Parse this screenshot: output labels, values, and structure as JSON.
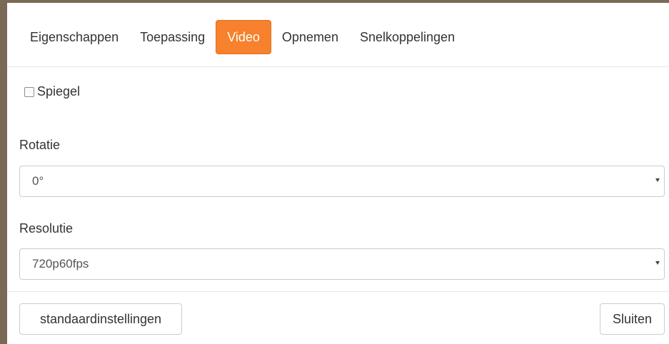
{
  "tabs": [
    {
      "label": "Eigenschappen",
      "active": false
    },
    {
      "label": "Toepassing",
      "active": false
    },
    {
      "label": "Video",
      "active": true
    },
    {
      "label": "Opnemen",
      "active": false
    },
    {
      "label": "Snelkoppelingen",
      "active": false
    }
  ],
  "mirror": {
    "label": "Spiegel",
    "checked": false
  },
  "rotation": {
    "label": "Rotatie",
    "value": "0°"
  },
  "resolution": {
    "label": "Resolutie",
    "value": "720p60fps"
  },
  "footer": {
    "defaults_label": "standaardinstellingen",
    "close_label": "Sluiten"
  },
  "colors": {
    "accent": "#f7812c",
    "window_border": "#7a6a55"
  },
  "icons": {
    "dropdown": "caret-down-icon",
    "checkbox": "checkbox-unchecked-icon"
  }
}
